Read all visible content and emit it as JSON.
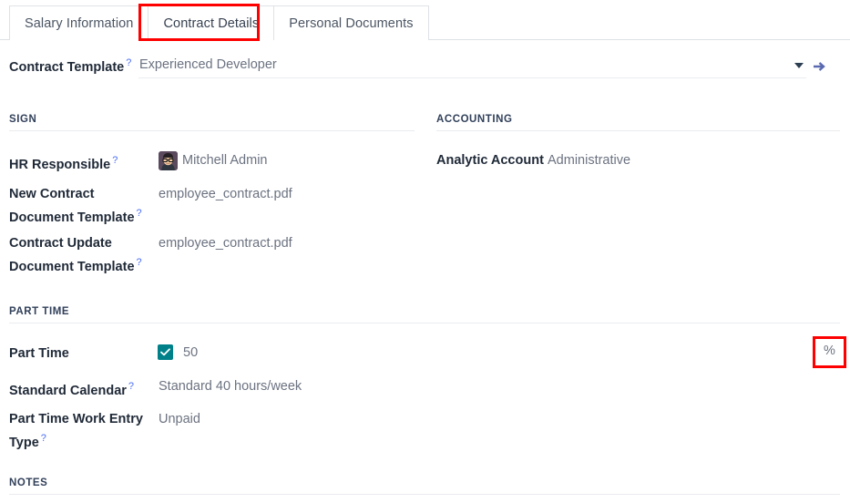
{
  "tabs": [
    {
      "label": "Salary Information",
      "active": false
    },
    {
      "label": "Contract Details",
      "active": true
    },
    {
      "label": "Personal Documents",
      "active": false
    }
  ],
  "contract_template": {
    "label": "Contract Template",
    "help": "?",
    "value": "Experienced Developer",
    "dropdown_icon": "chevron-down-icon",
    "internal_link_icon": "arrow-right-icon"
  },
  "sections": {
    "sign": {
      "title": "SIGN",
      "fields": [
        {
          "label": "HR Responsible",
          "help": "?",
          "value": "Mitchell Admin",
          "avatar": "user-avatar"
        },
        {
          "label_line1": "New Contract",
          "label_line2": "Document Template",
          "help": "?",
          "value": "employee_contract.pdf"
        },
        {
          "label_line1": "Contract Update",
          "label_line2": "Document Template",
          "help": "?",
          "value": "employee_contract.pdf"
        }
      ]
    },
    "accounting": {
      "title": "ACCOUNTING",
      "fields": [
        {
          "label": "Analytic Account",
          "value": "Administrative"
        }
      ]
    },
    "part_time": {
      "title": "PART TIME",
      "fields": [
        {
          "label": "Part Time",
          "checked": true,
          "value": "50",
          "unit": "%"
        },
        {
          "label": "Standard Calendar",
          "help": "?",
          "value": "Standard 40 hours/week"
        },
        {
          "label_line1": "Part Time Work Entry",
          "label_line2": "Type",
          "help": "?",
          "value": "Unpaid"
        }
      ]
    },
    "notes": {
      "title": "NOTES"
    }
  },
  "colors": {
    "accent_blue": "#4c6ef5",
    "checkbox_teal": "#00818a",
    "annotation_red": "#fe0000",
    "label_dark": "#1f2937",
    "value_gray": "#6b7280"
  }
}
